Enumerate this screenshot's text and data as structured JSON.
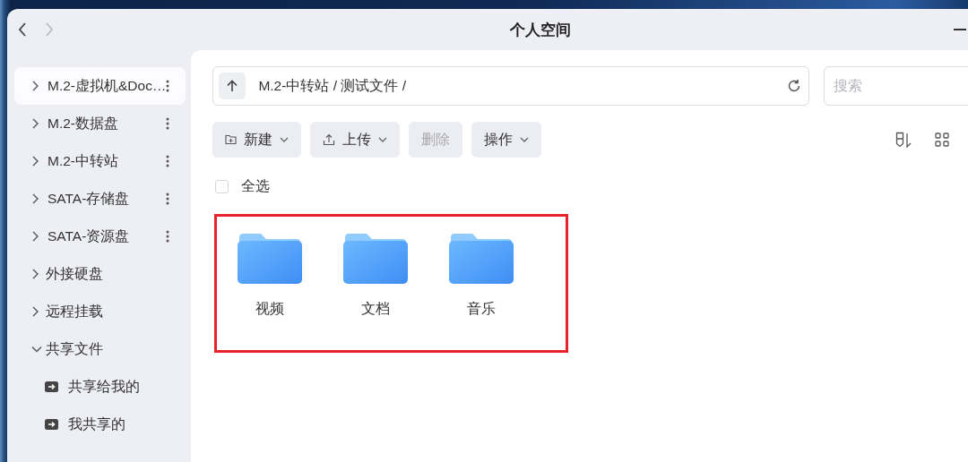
{
  "window": {
    "title": "个人空间"
  },
  "nav": {
    "back_enabled": true,
    "forward_enabled": false
  },
  "sidebar": {
    "items": [
      {
        "label": "M.2-虚拟机&Doc…",
        "kind": "volume",
        "selected": true,
        "expanded": false
      },
      {
        "label": "M.2-数据盘",
        "kind": "volume",
        "selected": false,
        "expanded": false
      },
      {
        "label": "M.2-中转站",
        "kind": "volume",
        "selected": false,
        "expanded": false
      },
      {
        "label": "SATA-存储盘",
        "kind": "volume",
        "selected": false,
        "expanded": false
      },
      {
        "label": "SATA-资源盘",
        "kind": "volume",
        "selected": false,
        "expanded": false
      },
      {
        "label": "外接硬盘",
        "kind": "group",
        "selected": false,
        "expanded": false
      },
      {
        "label": "远程挂载",
        "kind": "group",
        "selected": false,
        "expanded": false
      },
      {
        "label": "共享文件",
        "kind": "group",
        "selected": false,
        "expanded": true,
        "children": [
          {
            "label": "共享给我的",
            "kind": "share",
            "selected": false
          },
          {
            "label": "我共享的",
            "kind": "share",
            "selected": false
          }
        ]
      }
    ]
  },
  "path_bar": {
    "path": "M.2-中转站 / 测试文件 /"
  },
  "search": {
    "placeholder": "搜索"
  },
  "toolbar": [
    {
      "label": "新建",
      "kind": "new",
      "dropdown": true,
      "disabled": false
    },
    {
      "label": "上传",
      "kind": "upload",
      "dropdown": true,
      "disabled": false
    },
    {
      "label": "删除",
      "kind": "plain",
      "dropdown": false,
      "disabled": true
    },
    {
      "label": "操作",
      "kind": "plain",
      "dropdown": true,
      "disabled": false
    }
  ],
  "select_all": {
    "label": "全选",
    "checked": false
  },
  "folders": [
    {
      "name": "视频"
    },
    {
      "name": "文档"
    },
    {
      "name": "音乐"
    }
  ],
  "highlight_frame": true
}
